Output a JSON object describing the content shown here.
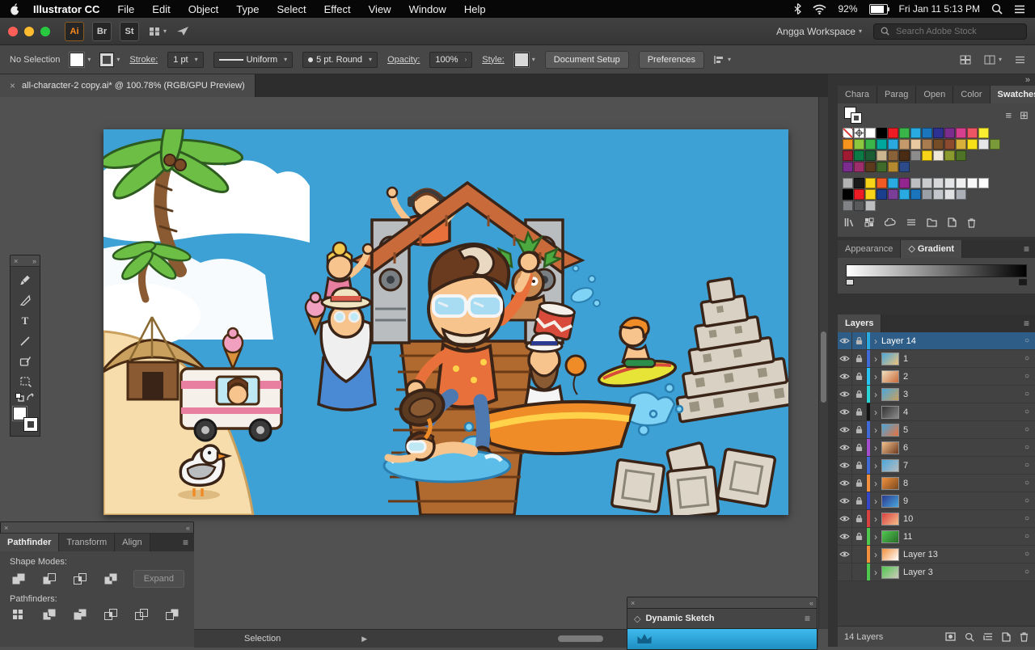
{
  "menubar": {
    "app_name": "Illustrator CC",
    "menus": [
      "File",
      "Edit",
      "Object",
      "Type",
      "Select",
      "Effect",
      "View",
      "Window",
      "Help"
    ],
    "battery_pct": "92%",
    "clock": "Fri Jan 11 5:13 PM"
  },
  "titlebar": {
    "ai_badge": "Ai",
    "br_badge": "Br",
    "st_badge": "St",
    "workspace_label": "Angga Workspace",
    "stock_search_placeholder": "Search Adobe Stock"
  },
  "controlbar": {
    "selection_status": "No Selection",
    "stroke_label": "Stroke:",
    "stroke_weight": "1 pt",
    "width_profile": "Uniform",
    "brush_definition": "5 pt. Round",
    "opacity_label": "Opacity:",
    "opacity_value": "100%",
    "style_label": "Style:",
    "document_setup_label": "Document Setup",
    "preferences_label": "Preferences"
  },
  "document_tab": {
    "title": "all-character-2 copy.ai* @ 100.78% (RGB/GPU Preview)"
  },
  "statusbar": {
    "tool_label": "Selection"
  },
  "toolbar_tools": [
    "paintbrush-tool",
    "blade-tool",
    "type-tool",
    "line-tool",
    "shaper-tool",
    "transform-tool"
  ],
  "pathfinder": {
    "tabs": [
      "Pathfinder",
      "Transform",
      "Align"
    ],
    "active_tab": "Pathfinder",
    "shape_modes_label": "Shape Modes:",
    "expand_label": "Expand",
    "pathfinders_label": "Pathfinders:",
    "shape_modes": [
      "unite",
      "minus-front",
      "intersect",
      "exclude"
    ],
    "pathfinder_ops": [
      "divide",
      "trim",
      "merge",
      "crop",
      "outline",
      "minus-back"
    ]
  },
  "dynamic_sketch": {
    "title": "Dynamic Sketch"
  },
  "dock": {
    "panel_tabs": [
      "Chara",
      "Parag",
      "Open",
      "Color",
      "Swatches"
    ],
    "active_panel_tab": "Swatches",
    "appearance_tabs": [
      "Appearance",
      "Gradient"
    ],
    "active_appearance_tab": "Gradient",
    "layers_tab_label": "Layers",
    "layers_count_label": "14 Layers"
  },
  "swatches": {
    "rows": [
      [
        "none",
        "reg",
        "#ffffff",
        "#000000",
        "#ed1c24",
        "#3ab54a",
        "#29abe2",
        "#1b75bc",
        "#2e3192",
        "#7b2d8e",
        "#d63e8e",
        "#ed5565",
        "#f9ed32"
      ],
      [
        "#f7941e",
        "#8dc63f",
        "#3ab54a",
        "#00a79d",
        "#2aa9e0",
        "#c49a6c",
        "#e8c9a0",
        "#a97c50",
        "#754c28",
        "#8c4a2f",
        "#d8b13a",
        "#f7e017",
        "#e6e7e8",
        "#7a9a3a"
      ],
      [
        "#9e1b32",
        "#0b7a45",
        "#1c5c34",
        "#cbb68f",
        "#8a6239",
        "#4a2c14",
        "#8c8c8c",
        "#f7d417",
        "#efe8d8",
        "#8a9a2e",
        "#4f7326"
      ],
      [
        "#7a2d8e",
        "#9e2d6b",
        "#5b3a1e",
        "#3f6b2a",
        "#b5892f",
        "#2d4a8a"
      ],
      [
        "#b3b3b3",
        "#1a1a1a",
        "#f7d417",
        "#f15a24",
        "#29abe2",
        "#93278f",
        "#bcbec0",
        "#c9cbcd",
        "#d6d8d9",
        "#e3e4e5",
        "#efefef",
        "#f9f9f9",
        "#ffffff"
      ],
      [
        "#000000",
        "#ed1c24",
        "#f7d417",
        "#1b3f8f",
        "#7a3e98",
        "#29abe2",
        "#1b75bc",
        "#9aa0a6",
        "#c4c8cc",
        "#dfe1e3",
        "#aab0b6"
      ],
      [
        "#808285",
        "#58595b",
        "#bcbec0"
      ]
    ]
  },
  "layers": [
    {
      "name": "Layer 14",
      "color": "#29abe2",
      "selected": true,
      "eye": true,
      "lock": true,
      "thumb": null
    },
    {
      "name": "1",
      "color": "#3f6ad8",
      "selected": false,
      "eye": true,
      "lock": true,
      "thumb": [
        "#49a7dc",
        "#f0c27a"
      ]
    },
    {
      "name": "2",
      "color": "#27c3f3",
      "selected": false,
      "eye": true,
      "lock": true,
      "thumb": [
        "#f0e0c0",
        "#c96a3a"
      ]
    },
    {
      "name": "3",
      "color": "#2bd4d4",
      "selected": false,
      "eye": true,
      "lock": true,
      "thumb": [
        "#49a7dc",
        "#caa05e"
      ]
    },
    {
      "name": "4",
      "color": "#151515",
      "selected": false,
      "eye": true,
      "lock": true,
      "thumb": [
        "#333333",
        "#8a8a8a"
      ]
    },
    {
      "name": "5",
      "color": "#3f6ad8",
      "selected": false,
      "eye": true,
      "lock": true,
      "thumb": [
        "#49a7dc",
        "#e8703a"
      ]
    },
    {
      "name": "6",
      "color": "#a54ccf",
      "selected": false,
      "eye": true,
      "lock": true,
      "thumb": [
        "#f5c08c",
        "#6b3b20"
      ]
    },
    {
      "name": "7",
      "color": "#3f6ad8",
      "selected": false,
      "eye": true,
      "lock": true,
      "thumb": [
        "#49a7dc",
        "#b9bdbf"
      ]
    },
    {
      "name": "8",
      "color": "#f2903d",
      "selected": false,
      "eye": true,
      "lock": true,
      "thumb": [
        "#f2903d",
        "#7a4a20"
      ]
    },
    {
      "name": "9",
      "color": "#3646c8",
      "selected": false,
      "eye": true,
      "lock": true,
      "thumb": [
        "#2b3990",
        "#49a7dc"
      ]
    },
    {
      "name": "10",
      "color": "#d94040",
      "selected": false,
      "eye": true,
      "lock": true,
      "thumb": [
        "#d94040",
        "#f5c08c"
      ]
    },
    {
      "name": "11",
      "color": "#4fc84f",
      "selected": false,
      "eye": true,
      "lock": true,
      "thumb": [
        "#4fc84f",
        "#2a6b2a"
      ]
    },
    {
      "name": "Layer 13",
      "color": "#f2903d",
      "selected": false,
      "eye": true,
      "lock": false,
      "thumb": [
        "#f2903d",
        "#ffffff"
      ]
    },
    {
      "name": "Layer 3",
      "color": "#4fc84f",
      "selected": false,
      "eye": false,
      "lock": false,
      "thumb": [
        "#4fc84f",
        "#cfc9bd"
      ]
    }
  ]
}
